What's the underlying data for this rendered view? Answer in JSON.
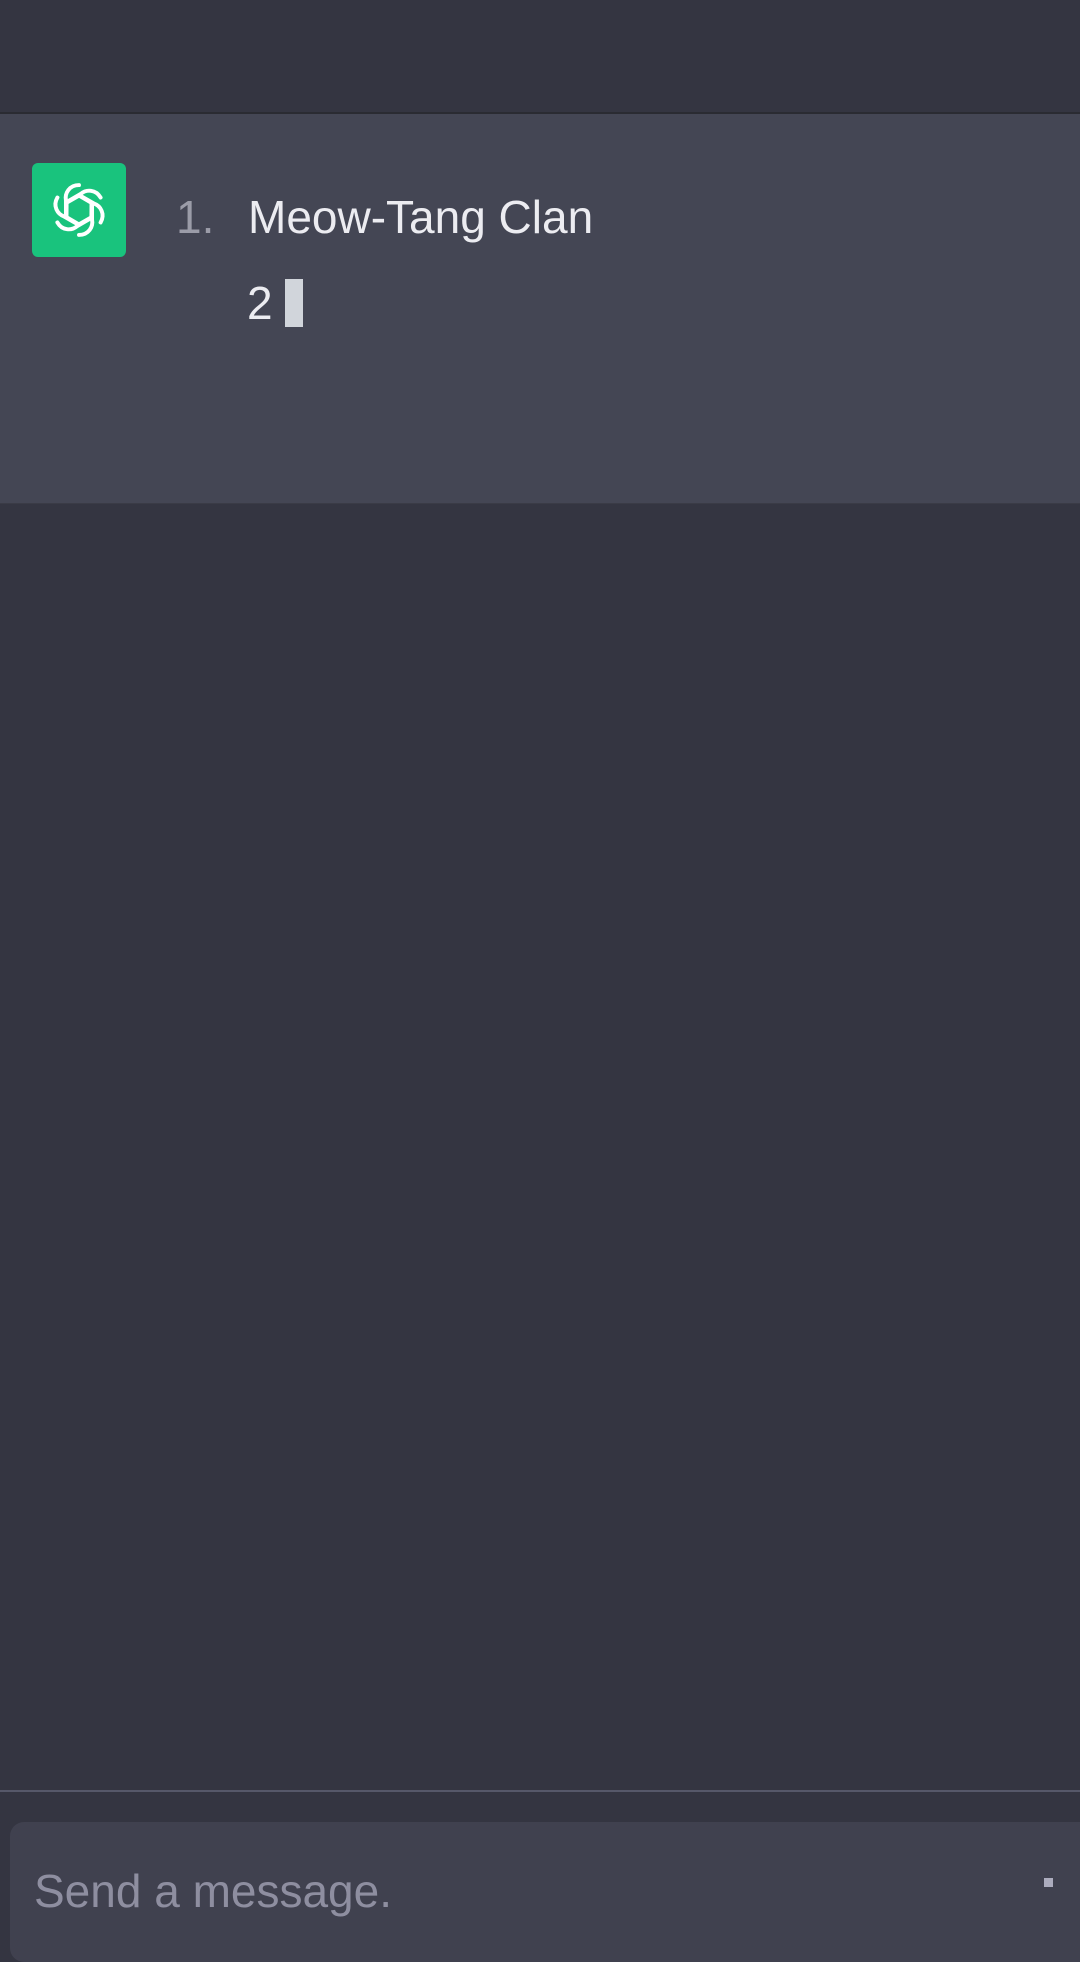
{
  "assistant": {
    "avatar_icon": "openai-logo-icon",
    "avatar_color": "#19c37d",
    "list": [
      {
        "marker": "1.",
        "text": "Meow-Tang Clan"
      }
    ],
    "streaming_text": "2"
  },
  "composer": {
    "placeholder": "Send a message."
  },
  "colors": {
    "background": "#343541",
    "message_background": "#444654",
    "text": "#ececf1"
  }
}
